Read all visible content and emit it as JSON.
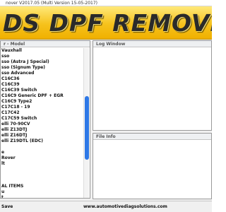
{
  "window": {
    "title": "nover V2017.05 (Multi Version 15-05-2017)"
  },
  "banner": {
    "title": "DS DPF REMOVE"
  },
  "model_panel": {
    "header": "r - Model",
    "items": [
      "Vauxhall",
      "sso",
      "sso (Astra J Special)",
      "sso (Signum Type)",
      "sso Advanced",
      "C16C36",
      "C16C39",
      "C16C39 Switch",
      "C16C9 Generic DPF + EGR",
      "C16C9 Type2",
      "C17C18 - 19",
      "C17C42",
      "C17C59 Switch",
      "elli 70-90CV",
      "elli Z13DTJ",
      "elli Z16DTJ",
      "elli Z19DTL (EDC)",
      "",
      "e",
      "Rover",
      "lt",
      "",
      "",
      "",
      "AL ITEMS",
      "u",
      "t",
      "",
      "e"
    ]
  },
  "log_panel": {
    "header": "Log Window"
  },
  "file_panel": {
    "header": "File Info"
  },
  "statusbar": {
    "save_label": "Save",
    "website": "www.automotivediagsolutions.com"
  }
}
